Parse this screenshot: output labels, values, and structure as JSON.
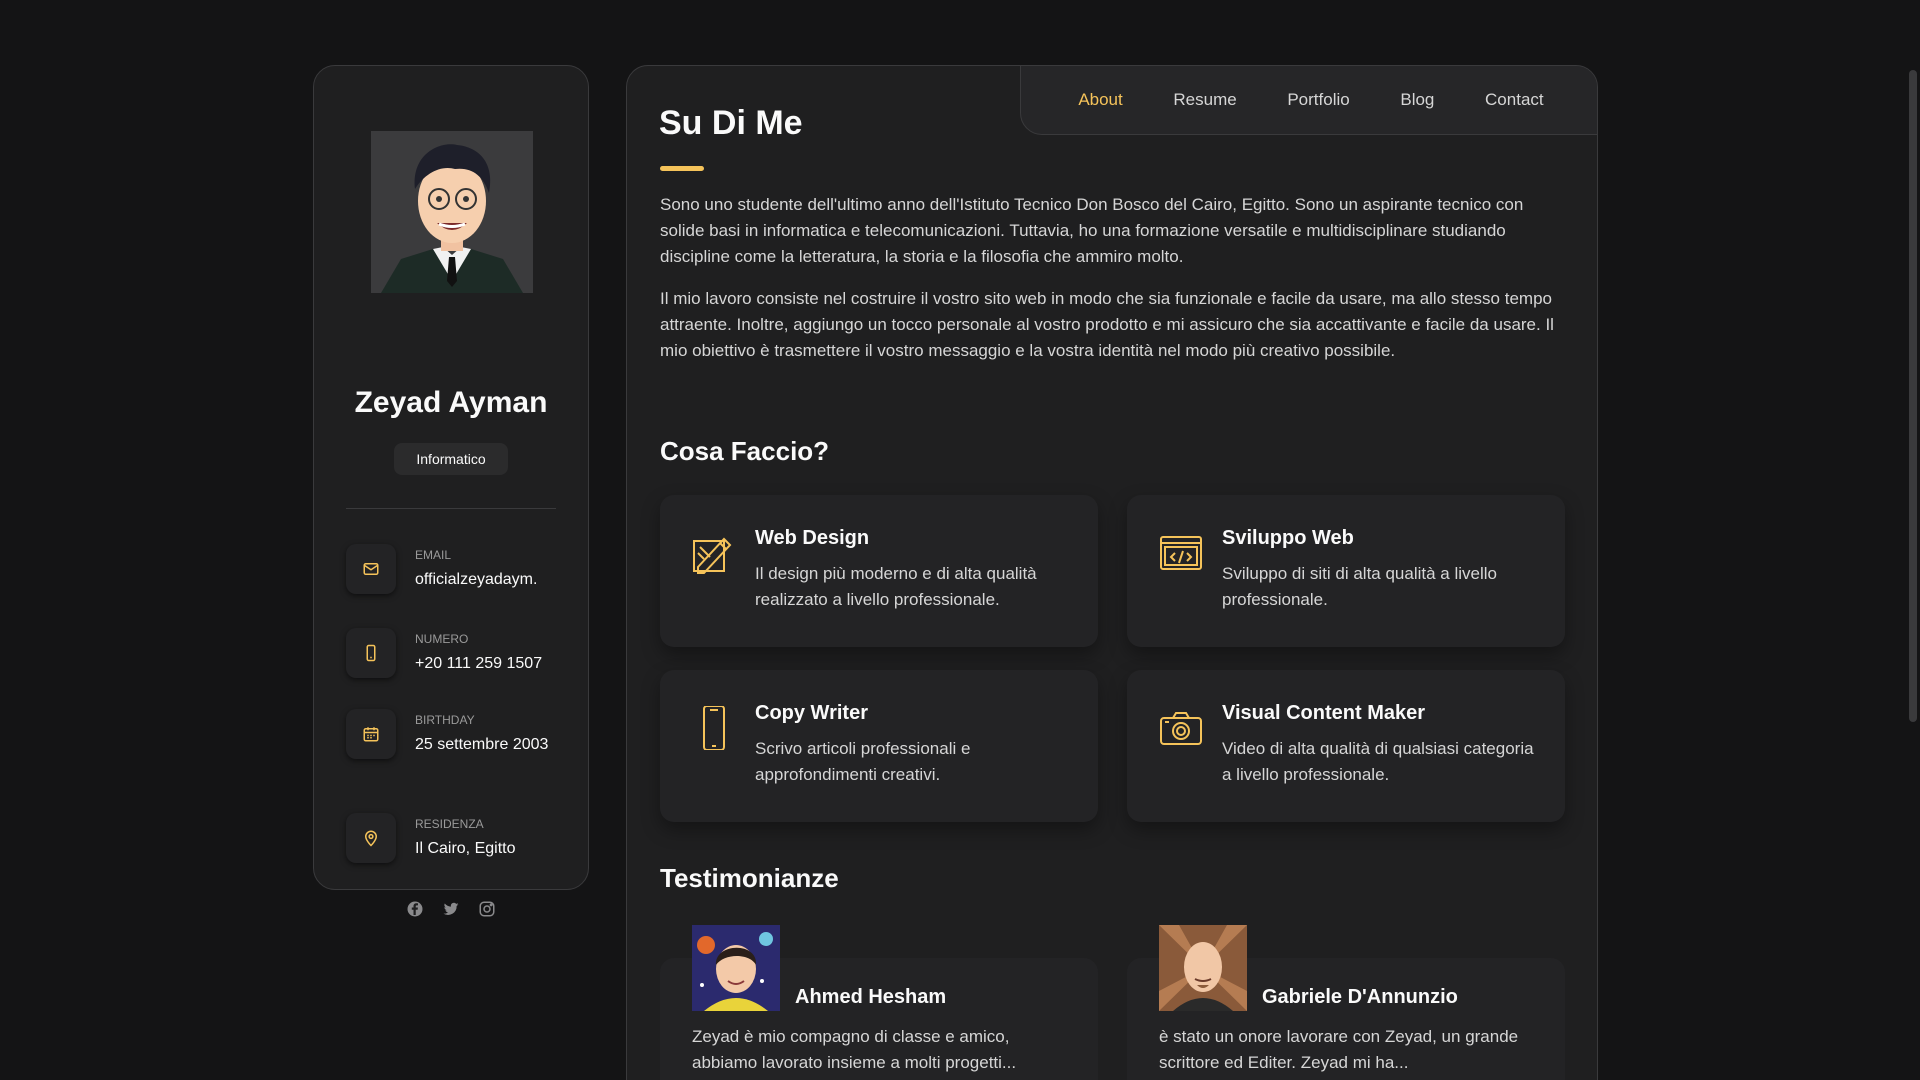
{
  "profile": {
    "name": "Zeyad Ayman",
    "title": "Informatico",
    "contacts": [
      {
        "label": "EMAIL",
        "value": "officialzeyadaym.",
        "icon": "mail-icon"
      },
      {
        "label": "NUMERO",
        "value": "+20 111 259 1507",
        "icon": "phone-icon"
      },
      {
        "label": "BIRTHDAY",
        "value": "25 settembre 2003",
        "icon": "calendar-icon"
      },
      {
        "label": "RESIDENZA",
        "value": "Il Cairo, Egitto",
        "icon": "location-pin-icon"
      }
    ],
    "socials": [
      "facebook-icon",
      "twitter-icon",
      "instagram-icon"
    ]
  },
  "nav": {
    "items": [
      "About",
      "Resume",
      "Portfolio",
      "Blog",
      "Contact"
    ],
    "active": "About"
  },
  "about": {
    "heading": "Su Di Me",
    "paragraphs": [
      "Sono uno studente dell'ultimo anno dell'Istituto Tecnico Don Bosco del Cairo, Egitto. Sono un aspirante tecnico con solide basi in informatica e telecomunicazioni. Tuttavia, ho una formazione versatile e multidisciplinare studiando discipline come la letteratura, la storia e la filosofia che ammiro molto.",
      "Il mio lavoro consiste nel costruire il vostro sito web in modo che sia funzionale e facile da usare, ma allo stesso tempo attraente. Inoltre, aggiungo un tocco personale al vostro prodotto e mi assicuro che sia accattivante e facile da usare. Il mio obiettivo è trasmettere il vostro messaggio e la vostra identità nel modo più creativo possibile."
    ]
  },
  "services": {
    "heading": "Cosa Faccio?",
    "items": [
      {
        "title": "Web Design",
        "text": "Il design più moderno e di alta qualità realizzato a livello professionale.",
        "icon": "design-pen-icon"
      },
      {
        "title": "Sviluppo Web",
        "text": "Sviluppo di siti di alta qualità a livello professionale.",
        "icon": "code-window-icon"
      },
      {
        "title": "Copy Writer",
        "text": "Scrivo articoli professionali e approfondimenti creativi.",
        "icon": "smartphone-icon"
      },
      {
        "title": "Visual Content Maker",
        "text": "Video di alta qualità di qualsiasi categoria a livello professionale.",
        "icon": "camera-icon"
      }
    ]
  },
  "testimonials": {
    "heading": "Testimonianze",
    "items": [
      {
        "name": "Ahmed Hesham",
        "text": "Zeyad è mio compagno di classe e amico, abbiamo lavorato insieme a molti progetti..."
      },
      {
        "name": "Gabriele D'Annunzio",
        "text": "è stato un onore lavorare con Zeyad, un grande scrittore ed Editer. Zeyad mi ha..."
      }
    ]
  },
  "colors": {
    "accent": "#f5c35a",
    "background": "#141415",
    "card": "#1f1f20"
  }
}
